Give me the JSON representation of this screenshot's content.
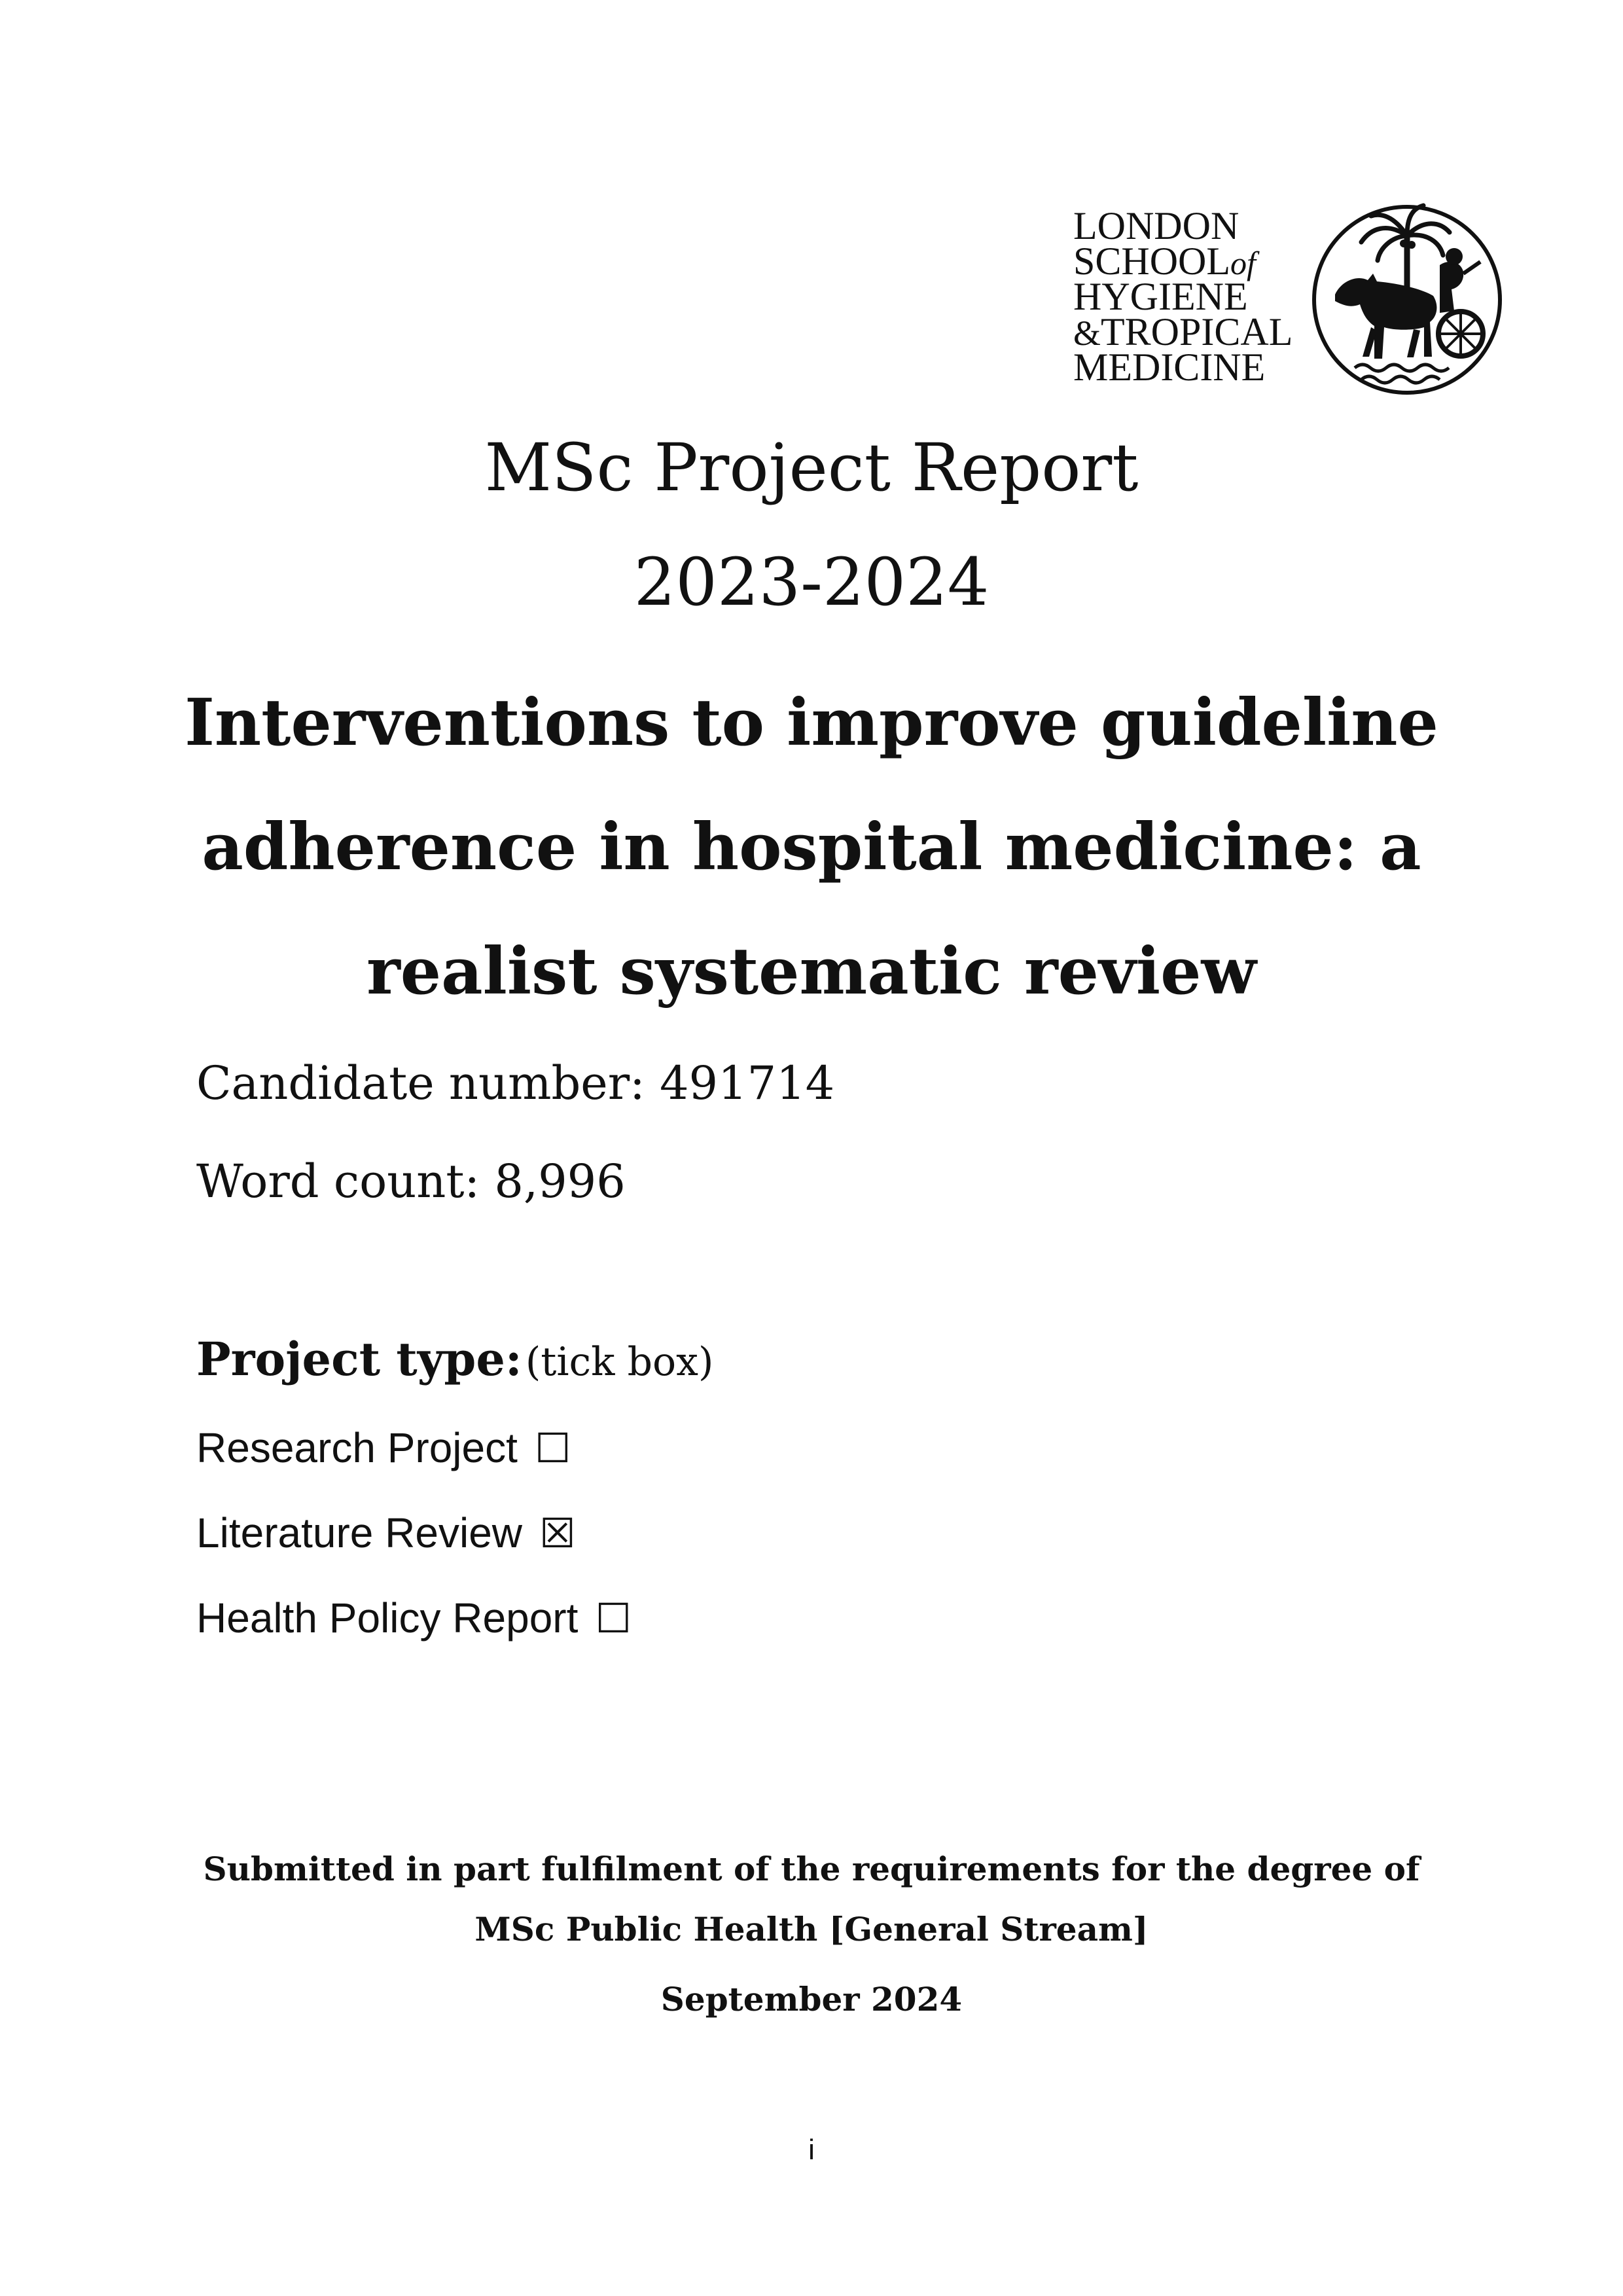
{
  "logo": {
    "lines": [
      "LONDON",
      "SCHOOL",
      "of",
      "HYGIENE",
      "&",
      "TROPICAL",
      "MEDICINE"
    ]
  },
  "report": {
    "title": "MSc Project Report",
    "year": "2023-2024",
    "main_title": "Interventions to improve guideline adherence in hospital medicine: a realist systematic review"
  },
  "meta": {
    "candidate": "Candidate number: 491714",
    "word_count": "Word count: 8,996"
  },
  "project_type": {
    "label": "Project type:",
    "hint": "(tick box)",
    "options": [
      {
        "label": "Research Project",
        "box": "☐"
      },
      {
        "label": "Literature Review",
        "box": "☒"
      },
      {
        "label": "Health Policy Report",
        "box": "☐"
      }
    ]
  },
  "footer": {
    "submitted_line1": "Submitted in part fulfilment of the requirements for the degree of",
    "submitted_line2": "MSc Public Health [General Stream]",
    "date": "September 2024",
    "page_number": "i"
  },
  "colors": {
    "text": "#111111",
    "background": "#ffffff"
  }
}
